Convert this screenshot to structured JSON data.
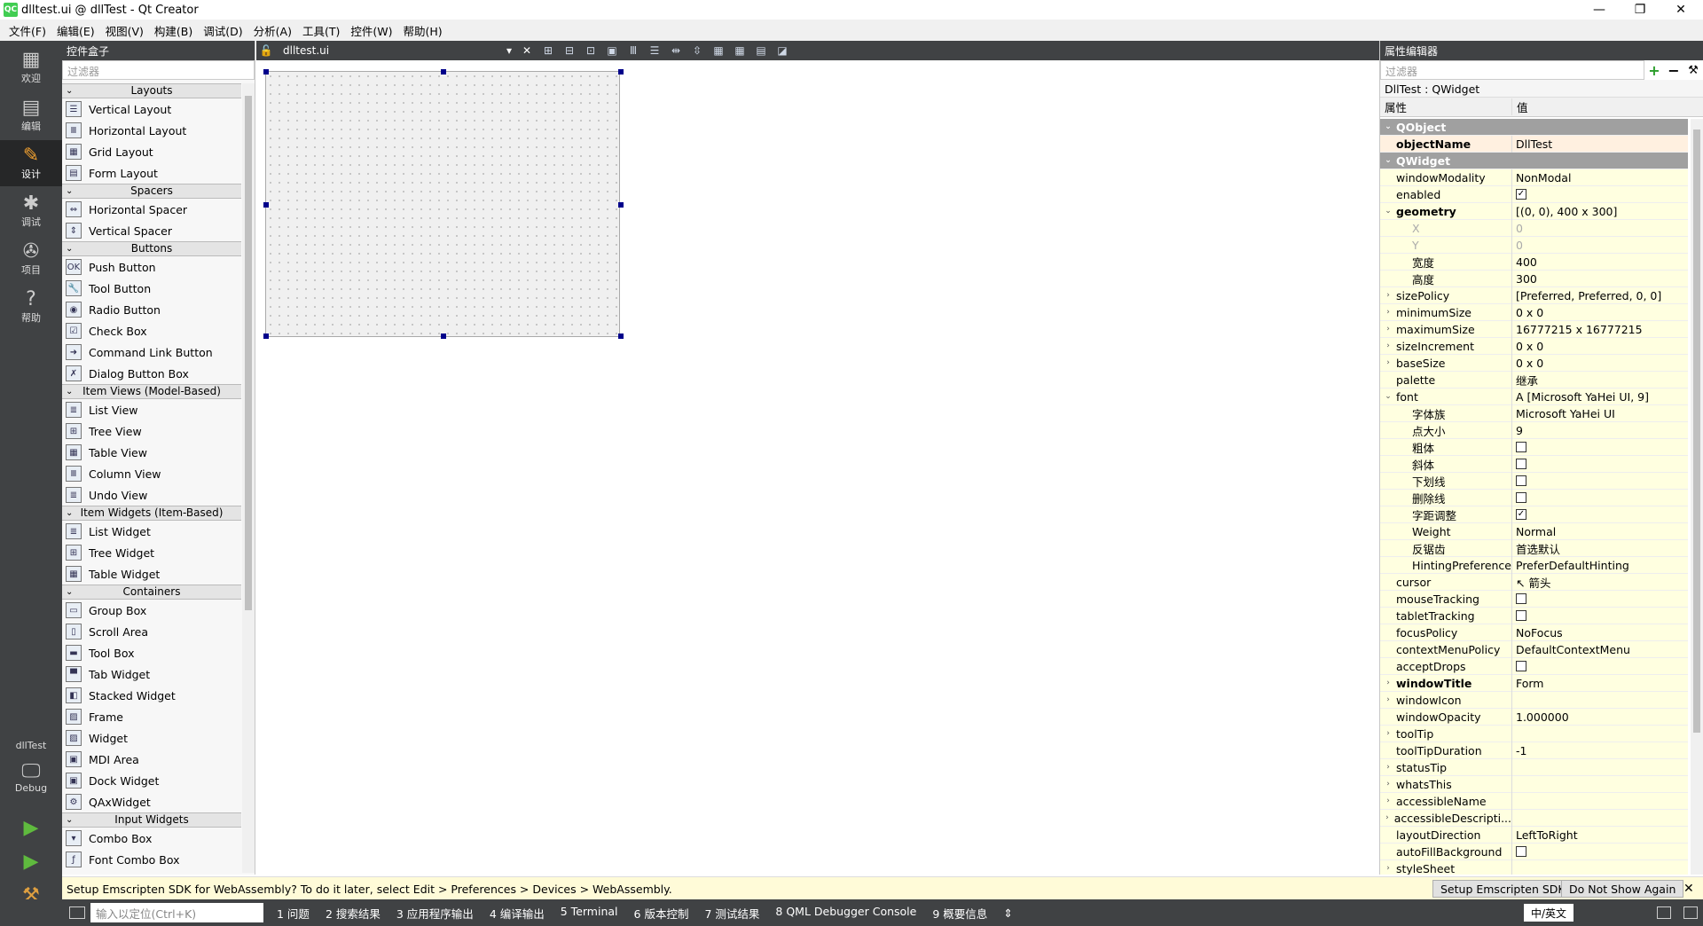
{
  "window": {
    "title": "dlltest.ui @ dllTest - Qt Creator",
    "app_icon": "QC",
    "minimize": "—",
    "restore": "❐",
    "close": "✕"
  },
  "menu": [
    "文件(F)",
    "编辑(E)",
    "视图(V)",
    "构建(B)",
    "调试(D)",
    "分析(A)",
    "工具(T)",
    "控件(W)",
    "帮助(H)"
  ],
  "modes": [
    {
      "label": "欢迎",
      "icon": "grid-icon",
      "glyph": "▦"
    },
    {
      "label": "编辑",
      "icon": "document-icon",
      "glyph": "▤"
    },
    {
      "label": "设计",
      "icon": "pencil-icon",
      "glyph": "✎"
    },
    {
      "label": "调试",
      "icon": "bug-icon",
      "glyph": "✱"
    },
    {
      "label": "项目",
      "icon": "wrench-icon",
      "glyph": "✇"
    },
    {
      "label": "帮助",
      "icon": "help-icon",
      "glyph": "?"
    }
  ],
  "kit": {
    "project": "dllTest",
    "config": "Debug",
    "glyph": "🖵"
  },
  "run": {
    "run_glyph": "▶",
    "debug_glyph": "▶",
    "build_glyph": "⚒"
  },
  "widget_box": {
    "title": "控件盒子",
    "filter_placeholder": "过滤器",
    "categories": [
      {
        "name": "Layouts",
        "items": [
          {
            "label": "Vertical Layout",
            "glyph": "☰"
          },
          {
            "label": "Horizontal Layout",
            "glyph": "Ⅲ"
          },
          {
            "label": "Grid Layout",
            "glyph": "▦"
          },
          {
            "label": "Form Layout",
            "glyph": "▤"
          }
        ]
      },
      {
        "name": "Spacers",
        "items": [
          {
            "label": "Horizontal Spacer",
            "glyph": "⇔"
          },
          {
            "label": "Vertical Spacer",
            "glyph": "⇕"
          }
        ]
      },
      {
        "name": "Buttons",
        "items": [
          {
            "label": "Push Button",
            "glyph": "OK"
          },
          {
            "label": "Tool Button",
            "glyph": "🔧"
          },
          {
            "label": "Radio Button",
            "glyph": "◉"
          },
          {
            "label": "Check Box",
            "glyph": "☑"
          },
          {
            "label": "Command Link Button",
            "glyph": "➜"
          },
          {
            "label": "Dialog Button Box",
            "glyph": "✗"
          }
        ]
      },
      {
        "name": "Item Views (Model-Based)",
        "items": [
          {
            "label": "List View",
            "glyph": "≣"
          },
          {
            "label": "Tree View",
            "glyph": "⊞"
          },
          {
            "label": "Table View",
            "glyph": "▦"
          },
          {
            "label": "Column View",
            "glyph": "Ⅲ"
          },
          {
            "label": "Undo View",
            "glyph": "≣"
          }
        ]
      },
      {
        "name": "Item Widgets (Item-Based)",
        "items": [
          {
            "label": "List Widget",
            "glyph": "≣"
          },
          {
            "label": "Tree Widget",
            "glyph": "⊞"
          },
          {
            "label": "Table Widget",
            "glyph": "▦"
          }
        ]
      },
      {
        "name": "Containers",
        "items": [
          {
            "label": "Group Box",
            "glyph": "▭"
          },
          {
            "label": "Scroll Area",
            "glyph": "▯"
          },
          {
            "label": "Tool Box",
            "glyph": "▬"
          },
          {
            "label": "Tab Widget",
            "glyph": "▀"
          },
          {
            "label": "Stacked Widget",
            "glyph": "◧"
          },
          {
            "label": "Frame",
            "glyph": "▨"
          },
          {
            "label": "Widget",
            "glyph": "▨"
          },
          {
            "label": "MDI Area",
            "glyph": "▣"
          },
          {
            "label": "Dock Widget",
            "glyph": "▣"
          },
          {
            "label": "QAxWidget",
            "glyph": "⚙"
          }
        ]
      },
      {
        "name": "Input Widgets",
        "items": [
          {
            "label": "Combo Box",
            "glyph": "▾"
          },
          {
            "label": "Font Combo Box",
            "glyph": "ƒ"
          }
        ]
      }
    ]
  },
  "editor": {
    "tab_label": "dlltest.ui",
    "close": "✕",
    "dropdown": "▾",
    "lock": "🔓",
    "tools": [
      "⊞",
      "⊟",
      "⊡",
      "▣",
      "Ⅲ",
      "☰",
      "⇹",
      "⇳",
      "▦",
      "▦",
      "▤",
      "◪"
    ]
  },
  "properties": {
    "title": "属性编辑器",
    "filter_placeholder": "过滤器",
    "add": "+",
    "remove": "−",
    "config": "⚒",
    "object_line": "DllTest : QWidget",
    "col_property": "属性",
    "col_value": "值",
    "rows": [
      {
        "name": "QObject",
        "value": "",
        "type": "group"
      },
      {
        "name": "objectName",
        "value": "DllTest",
        "type": "bold",
        "bg": "o"
      },
      {
        "name": "QWidget",
        "value": "",
        "type": "group"
      },
      {
        "name": "windowModality",
        "value": "NonModal",
        "bg": "y"
      },
      {
        "name": "enabled",
        "value": "",
        "check": true,
        "bg": "y"
      },
      {
        "name": "geometry",
        "value": "[(0, 0), 400 x 300]",
        "type": "bold",
        "expand": "open",
        "bg": "y"
      },
      {
        "name": "X",
        "value": "0",
        "type": "subdis",
        "bg": "y"
      },
      {
        "name": "Y",
        "value": "0",
        "type": "subdis",
        "bg": "y"
      },
      {
        "name": "宽度",
        "value": "400",
        "type": "sub",
        "bg": "y"
      },
      {
        "name": "高度",
        "value": "300",
        "type": "sub",
        "bg": "y"
      },
      {
        "name": "sizePolicy",
        "value": "[Preferred, Preferred, 0, 0]",
        "expand": "closed",
        "bg": "y"
      },
      {
        "name": "minimumSize",
        "value": "0 x 0",
        "expand": "closed",
        "bg": "y"
      },
      {
        "name": "maximumSize",
        "value": "16777215 x 16777215",
        "expand": "closed",
        "bg": "y"
      },
      {
        "name": "sizeIncrement",
        "value": "0 x 0",
        "expand": "closed",
        "bg": "y"
      },
      {
        "name": "baseSize",
        "value": "0 x 0",
        "expand": "closed",
        "bg": "y"
      },
      {
        "name": "palette",
        "value": "继承",
        "bg": "y"
      },
      {
        "name": "font",
        "value": "A  [Microsoft YaHei UI, 9]",
        "expand": "open",
        "bg": "y"
      },
      {
        "name": "字体族",
        "value": "Microsoft YaHei UI",
        "type": "sub",
        "bg": "y"
      },
      {
        "name": "点大小",
        "value": "9",
        "type": "sub",
        "bg": "y"
      },
      {
        "name": "粗体",
        "value": "",
        "check": false,
        "type": "sub",
        "bg": "y"
      },
      {
        "name": "斜体",
        "value": "",
        "check": false,
        "type": "sub",
        "bg": "y"
      },
      {
        "name": "下划线",
        "value": "",
        "check": false,
        "type": "sub",
        "bg": "y"
      },
      {
        "name": "删除线",
        "value": "",
        "check": false,
        "type": "sub",
        "bg": "y"
      },
      {
        "name": "字距调整",
        "value": "",
        "check": true,
        "type": "sub",
        "bg": "y"
      },
      {
        "name": "Weight",
        "value": "Normal",
        "type": "sub",
        "bg": "y"
      },
      {
        "name": "反锯齿",
        "value": "首选默认",
        "type": "sub",
        "bg": "y"
      },
      {
        "name": "HintingPreference",
        "value": "PreferDefaultHinting",
        "type": "sub",
        "bg": "y"
      },
      {
        "name": "cursor",
        "value": "↖  箭头",
        "bg": "y"
      },
      {
        "name": "mouseTracking",
        "value": "",
        "check": false,
        "bg": "y"
      },
      {
        "name": "tabletTracking",
        "value": "",
        "check": false,
        "bg": "y"
      },
      {
        "name": "focusPolicy",
        "value": "NoFocus",
        "bg": "y"
      },
      {
        "name": "contextMenuPolicy",
        "value": "DefaultContextMenu",
        "bg": "y"
      },
      {
        "name": "acceptDrops",
        "value": "",
        "check": false,
        "bg": "y"
      },
      {
        "name": "windowTitle",
        "value": "Form",
        "type": "bold",
        "expand": "closed",
        "bg": "y"
      },
      {
        "name": "windowIcon",
        "value": "",
        "expand": "closed",
        "bg": "y"
      },
      {
        "name": "windowOpacity",
        "value": "1.000000",
        "bg": "y"
      },
      {
        "name": "toolTip",
        "value": "",
        "expand": "closed",
        "bg": "y"
      },
      {
        "name": "toolTipDuration",
        "value": "-1",
        "bg": "y"
      },
      {
        "name": "statusTip",
        "value": "",
        "expand": "closed",
        "bg": "y"
      },
      {
        "name": "whatsThis",
        "value": "",
        "expand": "closed",
        "bg": "y"
      },
      {
        "name": "accessibleName",
        "value": "",
        "expand": "closed",
        "bg": "y"
      },
      {
        "name": "accessibleDescripti...",
        "value": "",
        "expand": "closed",
        "bg": "y"
      },
      {
        "name": "layoutDirection",
        "value": "LeftToRight",
        "bg": "y"
      },
      {
        "name": "autoFillBackground",
        "value": "",
        "check": false,
        "bg": "y"
      },
      {
        "name": "styleSheet",
        "value": "",
        "expand": "closed",
        "bg": "y"
      }
    ]
  },
  "notification": {
    "text": "Setup Emscripten SDK for WebAssembly? To do it later, select Edit > Preferences > Devices > WebAssembly.",
    "setup_button": "Setup Emscripten SDK",
    "dismiss_button": "Do Not Show Again",
    "close": "✕"
  },
  "statusbar": {
    "locator_placeholder": "输入以定位(Ctrl+K)",
    "outputs": [
      "1 问题",
      "2 搜索结果",
      "3 应用程序输出",
      "4 编译输出",
      "5 Terminal",
      "6 版本控制",
      "7 测试结果",
      "8 QML Debugger Console",
      "9 概要信息"
    ],
    "more": "⇕",
    "ime": "中/英文"
  }
}
